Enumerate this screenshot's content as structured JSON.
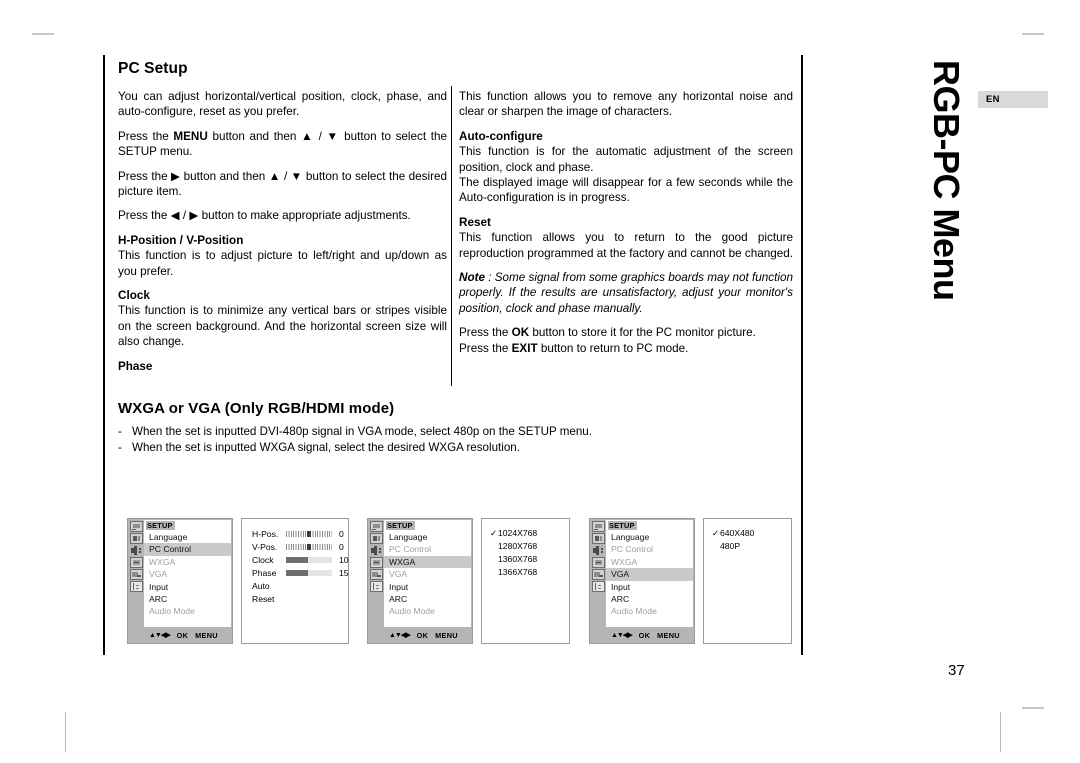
{
  "document": {
    "page_number": "37",
    "language_badge": "EN",
    "side_tab_title": "RGB-PC Menu"
  },
  "sections": {
    "pc_setup": {
      "heading": "PC Setup",
      "left_column": {
        "intro": "You can adjust horizontal/vertical position, clock, phase, and auto-configure, reset as you prefer.",
        "step1_a": "Press the ",
        "step1_b": "MENU",
        "step1_c": " button and then ▲ / ▼ button to select the SETUP menu.",
        "step2": "Press the ▶ button and then ▲ / ▼ button to select the desired picture item.",
        "step3": "Press the ◀ / ▶ button to make appropriate adjustments.",
        "hpos_heading_a": "H-Position",
        "hpos_heading_b": " / ",
        "hpos_heading_c": "V-Position",
        "hpos_body": "This function is to adjust picture to left/right and up/down as you prefer.",
        "clock_heading": "Clock",
        "clock_body": "This function is to minimize any vertical bars or stripes visible on the screen background. And the horizontal screen size will also change.",
        "phase_heading": "Phase"
      },
      "right_column": {
        "phase_body": "This function allows you to remove any horizontal noise and clear or sharpen the image of characters.",
        "auto_heading": "Auto-configure",
        "auto_body_1": "This function is for the automatic adjustment of the screen position, clock and phase.",
        "auto_body_2": "The displayed image will disappear for a few seconds while the Auto-configuration is in progress.",
        "reset_heading": "Reset",
        "reset_body": "This function allows you to return to the good picture reproduction programmed at the factory and cannot be changed.",
        "note_label": "Note",
        "note_sep": " : ",
        "note_body": "Some signal from some graphics boards may not function properly. If the results are unsatisfactory, adjust your monitor's position, clock and phase manually.",
        "ok_a": "Press the ",
        "ok_b": "OK",
        "ok_c": " button to store it for the PC monitor picture.",
        "exit_a": "Press the ",
        "exit_b": "EXIT",
        "exit_c": " button to return to PC mode."
      }
    },
    "wxga_vga": {
      "heading": "WXGA or VGA (Only RGB/HDMI mode)",
      "bullets": [
        "When the set is inputted DVI-480p signal in VGA mode, select 480p on the SETUP menu.",
        "When the set is inputted WXGA signal, select the desired WXGA resolution."
      ],
      "bullet_marker": "-"
    }
  },
  "osd_screens": [
    {
      "title": "SETUP",
      "menu_items": [
        {
          "label": "Language",
          "state": "normal"
        },
        {
          "label": "PC Control",
          "state": "selected"
        },
        {
          "label": "WXGA",
          "state": "disabled"
        },
        {
          "label": "VGA",
          "state": "disabled"
        },
        {
          "label": "Input",
          "state": "normal"
        },
        {
          "label": "ARC",
          "state": "normal"
        },
        {
          "label": "Audio Mode",
          "state": "disabled"
        }
      ],
      "nav": {
        "arrows": "▲▼◀▶",
        "ok": "OK",
        "menu": "MENU"
      },
      "value_rows": [
        {
          "name": "H-Pos.",
          "bar": "centered",
          "percent": 50,
          "value": "0"
        },
        {
          "name": "V-Pos.",
          "bar": "centered",
          "percent": 50,
          "value": "0"
        },
        {
          "name": "Clock",
          "bar": "fill",
          "percent": 48,
          "value": "10"
        },
        {
          "name": "Phase",
          "bar": "fill",
          "percent": 48,
          "value": "15"
        },
        {
          "name": "Auto",
          "bar": "none",
          "value": ""
        },
        {
          "name": "Reset",
          "bar": "none",
          "value": ""
        }
      ],
      "options": []
    },
    {
      "title": "SETUP",
      "menu_items": [
        {
          "label": "Language",
          "state": "normal"
        },
        {
          "label": "PC Control",
          "state": "disabled"
        },
        {
          "label": "WXGA",
          "state": "selected"
        },
        {
          "label": "VGA",
          "state": "disabled"
        },
        {
          "label": "Input",
          "state": "normal"
        },
        {
          "label": "ARC",
          "state": "normal"
        },
        {
          "label": "Audio Mode",
          "state": "disabled"
        }
      ],
      "nav": {
        "arrows": "▲▼◀▶",
        "ok": "OK",
        "menu": "MENU"
      },
      "value_rows": [],
      "options": [
        {
          "label": "1024X768",
          "checked": true
        },
        {
          "label": "1280X768",
          "checked": false
        },
        {
          "label": "1360X768",
          "checked": false
        },
        {
          "label": "1366X768",
          "checked": false
        }
      ]
    },
    {
      "title": "SETUP",
      "menu_items": [
        {
          "label": "Language",
          "state": "normal"
        },
        {
          "label": "PC Control",
          "state": "disabled"
        },
        {
          "label": "WXGA",
          "state": "disabled"
        },
        {
          "label": "VGA",
          "state": "selected"
        },
        {
          "label": "Input",
          "state": "normal"
        },
        {
          "label": "ARC",
          "state": "normal"
        },
        {
          "label": "Audio Mode",
          "state": "disabled"
        }
      ],
      "nav": {
        "arrows": "▲▼◀▶",
        "ok": "OK",
        "menu": "MENU"
      },
      "value_rows": [],
      "options": [
        {
          "label": "640X480",
          "checked": true
        },
        {
          "label": "480P",
          "checked": false
        }
      ]
    }
  ],
  "icon_names": [
    "tv-icon",
    "monitor-icon",
    "speaker-icon",
    "picture-icon",
    "input-icon",
    "book-icon"
  ],
  "colors": {
    "osd_chrome": "#b5b5b5",
    "osd_selected": "#c9c9c9",
    "badge_bg": "#d9d9d9",
    "text": "#000000",
    "dim_text": "#9e9e9e"
  }
}
